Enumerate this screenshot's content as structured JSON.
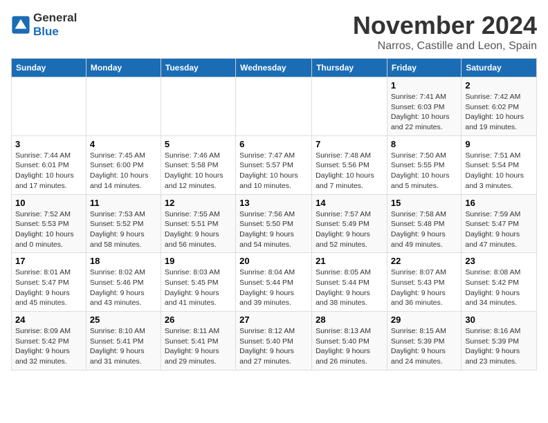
{
  "header": {
    "logo_line1": "General",
    "logo_line2": "Blue",
    "month": "November 2024",
    "location": "Narros, Castille and Leon, Spain"
  },
  "weekdays": [
    "Sunday",
    "Monday",
    "Tuesday",
    "Wednesday",
    "Thursday",
    "Friday",
    "Saturday"
  ],
  "weeks": [
    [
      {
        "day": "",
        "detail": ""
      },
      {
        "day": "",
        "detail": ""
      },
      {
        "day": "",
        "detail": ""
      },
      {
        "day": "",
        "detail": ""
      },
      {
        "day": "",
        "detail": ""
      },
      {
        "day": "1",
        "detail": "Sunrise: 7:41 AM\nSunset: 6:03 PM\nDaylight: 10 hours and 22 minutes."
      },
      {
        "day": "2",
        "detail": "Sunrise: 7:42 AM\nSunset: 6:02 PM\nDaylight: 10 hours and 19 minutes."
      }
    ],
    [
      {
        "day": "3",
        "detail": "Sunrise: 7:44 AM\nSunset: 6:01 PM\nDaylight: 10 hours and 17 minutes."
      },
      {
        "day": "4",
        "detail": "Sunrise: 7:45 AM\nSunset: 6:00 PM\nDaylight: 10 hours and 14 minutes."
      },
      {
        "day": "5",
        "detail": "Sunrise: 7:46 AM\nSunset: 5:58 PM\nDaylight: 10 hours and 12 minutes."
      },
      {
        "day": "6",
        "detail": "Sunrise: 7:47 AM\nSunset: 5:57 PM\nDaylight: 10 hours and 10 minutes."
      },
      {
        "day": "7",
        "detail": "Sunrise: 7:48 AM\nSunset: 5:56 PM\nDaylight: 10 hours and 7 minutes."
      },
      {
        "day": "8",
        "detail": "Sunrise: 7:50 AM\nSunset: 5:55 PM\nDaylight: 10 hours and 5 minutes."
      },
      {
        "day": "9",
        "detail": "Sunrise: 7:51 AM\nSunset: 5:54 PM\nDaylight: 10 hours and 3 minutes."
      }
    ],
    [
      {
        "day": "10",
        "detail": "Sunrise: 7:52 AM\nSunset: 5:53 PM\nDaylight: 10 hours and 0 minutes."
      },
      {
        "day": "11",
        "detail": "Sunrise: 7:53 AM\nSunset: 5:52 PM\nDaylight: 9 hours and 58 minutes."
      },
      {
        "day": "12",
        "detail": "Sunrise: 7:55 AM\nSunset: 5:51 PM\nDaylight: 9 hours and 56 minutes."
      },
      {
        "day": "13",
        "detail": "Sunrise: 7:56 AM\nSunset: 5:50 PM\nDaylight: 9 hours and 54 minutes."
      },
      {
        "day": "14",
        "detail": "Sunrise: 7:57 AM\nSunset: 5:49 PM\nDaylight: 9 hours and 52 minutes."
      },
      {
        "day": "15",
        "detail": "Sunrise: 7:58 AM\nSunset: 5:48 PM\nDaylight: 9 hours and 49 minutes."
      },
      {
        "day": "16",
        "detail": "Sunrise: 7:59 AM\nSunset: 5:47 PM\nDaylight: 9 hours and 47 minutes."
      }
    ],
    [
      {
        "day": "17",
        "detail": "Sunrise: 8:01 AM\nSunset: 5:47 PM\nDaylight: 9 hours and 45 minutes."
      },
      {
        "day": "18",
        "detail": "Sunrise: 8:02 AM\nSunset: 5:46 PM\nDaylight: 9 hours and 43 minutes."
      },
      {
        "day": "19",
        "detail": "Sunrise: 8:03 AM\nSunset: 5:45 PM\nDaylight: 9 hours and 41 minutes."
      },
      {
        "day": "20",
        "detail": "Sunrise: 8:04 AM\nSunset: 5:44 PM\nDaylight: 9 hours and 39 minutes."
      },
      {
        "day": "21",
        "detail": "Sunrise: 8:05 AM\nSunset: 5:44 PM\nDaylight: 9 hours and 38 minutes."
      },
      {
        "day": "22",
        "detail": "Sunrise: 8:07 AM\nSunset: 5:43 PM\nDaylight: 9 hours and 36 minutes."
      },
      {
        "day": "23",
        "detail": "Sunrise: 8:08 AM\nSunset: 5:42 PM\nDaylight: 9 hours and 34 minutes."
      }
    ],
    [
      {
        "day": "24",
        "detail": "Sunrise: 8:09 AM\nSunset: 5:42 PM\nDaylight: 9 hours and 32 minutes."
      },
      {
        "day": "25",
        "detail": "Sunrise: 8:10 AM\nSunset: 5:41 PM\nDaylight: 9 hours and 31 minutes."
      },
      {
        "day": "26",
        "detail": "Sunrise: 8:11 AM\nSunset: 5:41 PM\nDaylight: 9 hours and 29 minutes."
      },
      {
        "day": "27",
        "detail": "Sunrise: 8:12 AM\nSunset: 5:40 PM\nDaylight: 9 hours and 27 minutes."
      },
      {
        "day": "28",
        "detail": "Sunrise: 8:13 AM\nSunset: 5:40 PM\nDaylight: 9 hours and 26 minutes."
      },
      {
        "day": "29",
        "detail": "Sunrise: 8:15 AM\nSunset: 5:39 PM\nDaylight: 9 hours and 24 minutes."
      },
      {
        "day": "30",
        "detail": "Sunrise: 8:16 AM\nSunset: 5:39 PM\nDaylight: 9 hours and 23 minutes."
      }
    ]
  ]
}
